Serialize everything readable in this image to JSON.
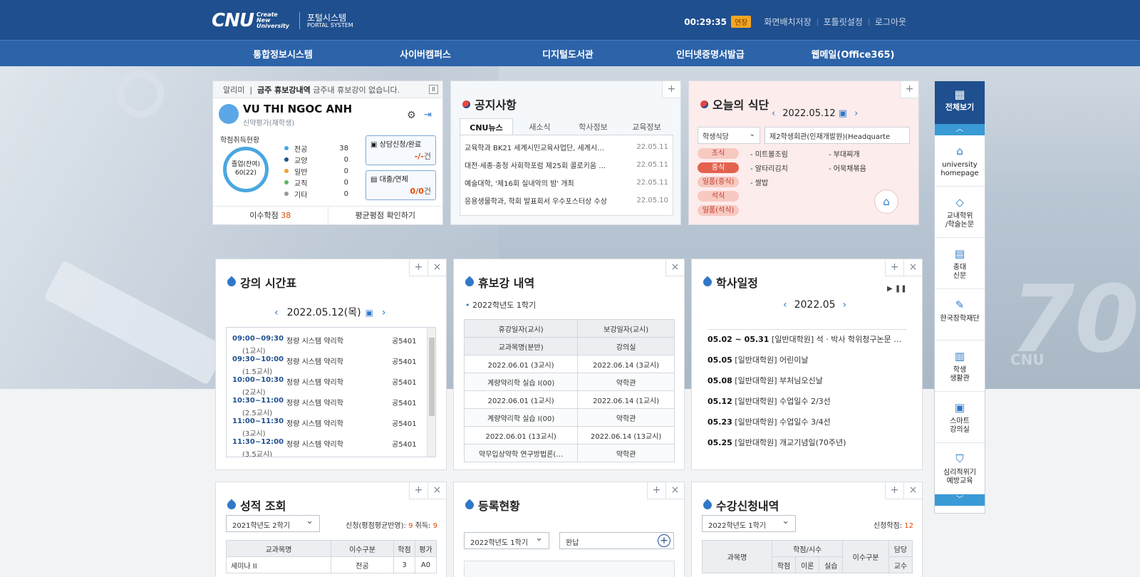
{
  "header": {
    "logo_main": "CNU",
    "logo_sub": "Create New University",
    "portal_kr": "포털시스템",
    "portal_en": "PORTAL SYSTEM",
    "timer": "00:29:35",
    "extend": "연장",
    "save_layout": "화면배치저장",
    "portlet_settings": "포틀릿설정",
    "logout": "로그아웃"
  },
  "nav": [
    "통합정보시스템",
    "사이버캠퍼스",
    "디지털도서관",
    "인터넷증명서발급",
    "웹메일(Office365)"
  ],
  "hero": {
    "watermark_num": "70",
    "watermark_text": "CNU"
  },
  "profile": {
    "notice_label": "알리미",
    "notice_title": "금주 휴보강내역",
    "notice_text": "금주내 휴보강이 없습니다.",
    "name": "VU THI NGOC ANH",
    "role": "신약평가(재학생)",
    "credit_title": "학점취득현황",
    "donut_l1": "졸업(잔여)",
    "donut_l2": "60(22)",
    "legend": [
      {
        "label": "전공",
        "value": "38",
        "color": "#4aa7e0"
      },
      {
        "label": "교양",
        "value": "0",
        "color": "#1f4f8e"
      },
      {
        "label": "일반",
        "value": "0",
        "color": "#f0a030"
      },
      {
        "label": "교직",
        "value": "0",
        "color": "#5cb85c"
      },
      {
        "label": "기타",
        "value": "0",
        "color": "#999999"
      }
    ],
    "consult_label": "상담신청/완료",
    "consult_count": "-/-",
    "consult_unit": "건",
    "loan_label": "대출/연체",
    "loan_count": "0/0",
    "loan_unit": "건",
    "completed_label": "이수학점",
    "completed_value": "38",
    "gpa_label": "평균평점 확인하기"
  },
  "notices": {
    "title": "공지사항",
    "tabs": [
      "CNU뉴스",
      "새소식",
      "학사정보",
      "교육정보"
    ],
    "rows": [
      {
        "text": "교육학과 BK21 세계시민교육사업단, 세계시…",
        "date": "22.05.11"
      },
      {
        "text": "대전·세종·충청 사회학포럼 제25회 콜로키움 …",
        "date": "22.05.11"
      },
      {
        "text": "예술대학, '제16회 실내악의 밤' 개최",
        "date": "22.05.11"
      },
      {
        "text": "응용생물학과, 학회 발표회서 우수포스터상 수상",
        "date": "22.05.10"
      }
    ]
  },
  "meal": {
    "title": "오늘의 식단",
    "date": "2022.05.12",
    "restaurant_type": "학생식당",
    "restaurant_name": "제2학생회관(인재개발원)(Headquarte",
    "meals": [
      {
        "tag": "조식",
        "food1": "- 미트볼조림",
        "food2": "- 부대찌개"
      },
      {
        "tag": "중식",
        "food1": "- 알타리김치",
        "food2": "- 어묵채볶음"
      },
      {
        "tag": "일품(중식)",
        "food1": "- 쌀밥",
        "food2": ""
      },
      {
        "tag": "석식",
        "food1": "",
        "food2": ""
      },
      {
        "tag": "일품(석식)",
        "food1": "",
        "food2": ""
      }
    ]
  },
  "quick": {
    "all": "전체보기",
    "items": [
      {
        "l1": "university",
        "l2": "homepage"
      },
      {
        "l1": "교내학위",
        "l2": "/학술논문"
      },
      {
        "l1": "충대",
        "l2": "신문"
      },
      {
        "l1": "한국장학재단",
        "l2": ""
      },
      {
        "l1": "학생",
        "l2": "생활관"
      },
      {
        "l1": "스마트",
        "l2": "강의실"
      },
      {
        "l1": "심리적위기",
        "l2": "예방교육"
      }
    ]
  },
  "timetable": {
    "title": "강의 시간표",
    "date": "2022.05.12(목)",
    "rows": [
      {
        "time": "09:00~09:30",
        "period": "(1교시)",
        "course": "정량 시스템 약리학",
        "room": "공5401"
      },
      {
        "time": "09:30~10:00",
        "period": "(1.5교시)",
        "course": "정량 시스템 약리학",
        "room": "공5401"
      },
      {
        "time": "10:00~10:30",
        "period": "(2교시)",
        "course": "정량 시스템 약리학",
        "room": "공5401"
      },
      {
        "time": "10:30~11:00",
        "period": "(2.5교시)",
        "course": "정량 시스템 약리학",
        "room": "공5401"
      },
      {
        "time": "11:00~11:30",
        "period": "(3교시)",
        "course": "정량 시스템 약리학",
        "room": "공5401"
      },
      {
        "time": "11:30~12:00",
        "period": "(3.5교시)",
        "course": "정량 시스템 약리학",
        "room": "공5401"
      }
    ]
  },
  "leave": {
    "title": "휴보강 내역",
    "semester": "2022학년도 1학기",
    "headers": [
      "휴강일자(교시)",
      "보강일자(교시)",
      "교과목명(분반)",
      "강의실"
    ],
    "rows": [
      [
        "2022.06.01 (3교시)",
        "2022.06.14 (3교시)"
      ],
      [
        "계량약리학 실습 I(00)",
        "약학관"
      ],
      [
        "2022.06.01 (1교시)",
        "2022.06.14 (1교시)"
      ],
      [
        "계량약리학 실습 I(00)",
        "약학관"
      ],
      [
        "2022.06.01 (13교시)",
        "2022.06.14 (13교시)"
      ],
      [
        "약무입상약학 연구방법론(…",
        "약학관"
      ]
    ]
  },
  "acal": {
    "title": "학사일정",
    "month": "2022.05",
    "events": [
      {
        "date": "05.02 ~ 05.31",
        "text": "[일반대학원] 석 · 박사 학위청구논문 …"
      },
      {
        "date": "05.05",
        "text": "[일반대학원] 어린이날"
      },
      {
        "date": "05.08",
        "text": "[일반대학원] 부처님오신날"
      },
      {
        "date": "05.12",
        "text": "[일반대학원] 수업일수 2/3선"
      },
      {
        "date": "05.23",
        "text": "[일반대학원] 수업일수 3/4선"
      },
      {
        "date": "05.25",
        "text": "[일반대학원] 개교기념일(70주년)"
      }
    ]
  },
  "grades": {
    "title": "성적 조회",
    "semester": "2021학년도 2학기",
    "info_label": "신청(평점평균반영):",
    "info_value": "9",
    "drop_label": "취득:",
    "drop_value": "9",
    "headers": [
      "교과목명",
      "이수구분",
      "학점",
      "평가"
    ],
    "row": [
      "세미나 II",
      "전공",
      "3",
      "A0"
    ]
  },
  "reg": {
    "title": "등록현황",
    "semester": "2022학년도 1학기",
    "status": "완납"
  },
  "enroll": {
    "title": "수강신청내역",
    "semester": "2022학년도 1학기",
    "info_label": "신청학점:",
    "info_value": "12",
    "h_course": "과목명",
    "h_credit": "학점/시수",
    "h_type": "이수구분",
    "h_prof1": "담당",
    "h_prof2": "교수",
    "sub": [
      "학점",
      "이론",
      "실습"
    ]
  }
}
